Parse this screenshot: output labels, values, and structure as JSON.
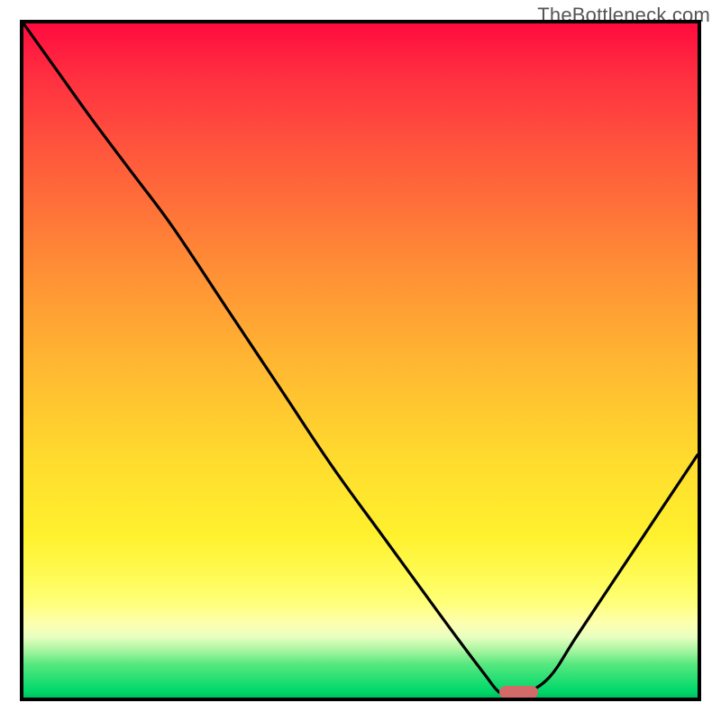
{
  "watermark": "TheBottleneck.com",
  "colors": {
    "frame": "#000000",
    "curve": "#000000",
    "marker": "#d36a6a",
    "gradient_top": "#ff0b3f",
    "gradient_mid": "#ffdc2e",
    "gradient_bottom": "#00d86a"
  },
  "chart_data": {
    "type": "line",
    "title": "",
    "xlabel": "",
    "ylabel": "",
    "xlim": [
      0,
      1
    ],
    "ylim": [
      0,
      1
    ],
    "note": "Axes have no visible tick labels; x and y are normalized across the plot box. y=1 is top (red), y=0 is bottom (green). Curve is a black V-shaped bottleneck trace with its minimum near x≈0.72.",
    "series": [
      {
        "name": "bottleneck-curve",
        "x": [
          0.0,
          0.05,
          0.1,
          0.16,
          0.22,
          0.3,
          0.38,
          0.46,
          0.54,
          0.62,
          0.68,
          0.71,
          0.74,
          0.78,
          0.82,
          0.88,
          0.94,
          1.0
        ],
        "y": [
          1.0,
          0.93,
          0.86,
          0.78,
          0.7,
          0.58,
          0.46,
          0.34,
          0.23,
          0.12,
          0.04,
          0.005,
          0.005,
          0.03,
          0.09,
          0.18,
          0.27,
          0.36
        ]
      }
    ],
    "marker": {
      "name": "optimal-point",
      "x": 0.735,
      "y": 0.008,
      "width_frac": 0.058,
      "height_frac": 0.019
    }
  }
}
